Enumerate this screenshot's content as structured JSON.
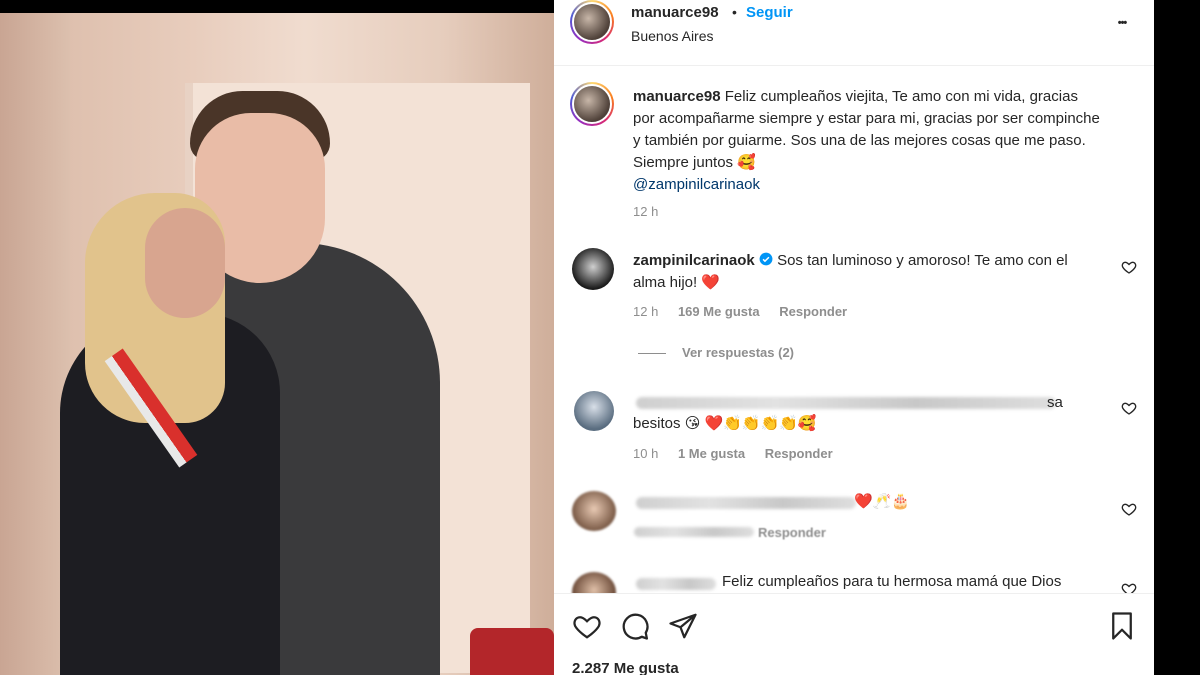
{
  "post": {
    "username": "manuarce98",
    "separator": "•",
    "follow_label": "Seguir",
    "location": "Buenos Aires",
    "more_label": "•••"
  },
  "caption": {
    "username": "manuarce98",
    "text": "Feliz cumpleaños viejita, Te amo con mi vida, gracias por acompañarme siempre y estar para mi, gracias por ser compinche y también por guiarme. Sos una de las mejores cosas que me paso. Siempre juntos 🥰",
    "mention": "@zampinilcarinaok",
    "time": "12 h"
  },
  "comments": [
    {
      "username": "zampinilcarinaok",
      "verified": true,
      "text": "Sos tan luminoso y amoroso! Te amo con el alma hijo! ❤️",
      "time": "12 h",
      "likes": "169 Me gusta",
      "reply": "Responder",
      "view_replies": "Ver respuestas (2)"
    },
    {
      "username": "",
      "text_suffix": "sa",
      "text": "besitos 😘 ❤️👏👏👏👏🥰",
      "time": "10 h",
      "likes": "1 Me gusta",
      "reply": "Responder"
    },
    {
      "username": "",
      "text": "❤️🥂🎂",
      "time": "",
      "likes": "",
      "reply": "Responder"
    },
    {
      "username": "",
      "text": "Feliz cumpleaños para tu hermosa mamá que Dios"
    }
  ],
  "footer": {
    "likes": "2.287 Me gusta"
  },
  "icons": {
    "like": "heart-icon",
    "comment": "comment-icon",
    "share": "send-icon",
    "save": "bookmark-icon",
    "verified": "verified-badge-icon"
  },
  "colors": {
    "link": "#0095f6",
    "mention": "#00376b",
    "secondary": "#8e8e8e",
    "verified": "#0095f6"
  }
}
